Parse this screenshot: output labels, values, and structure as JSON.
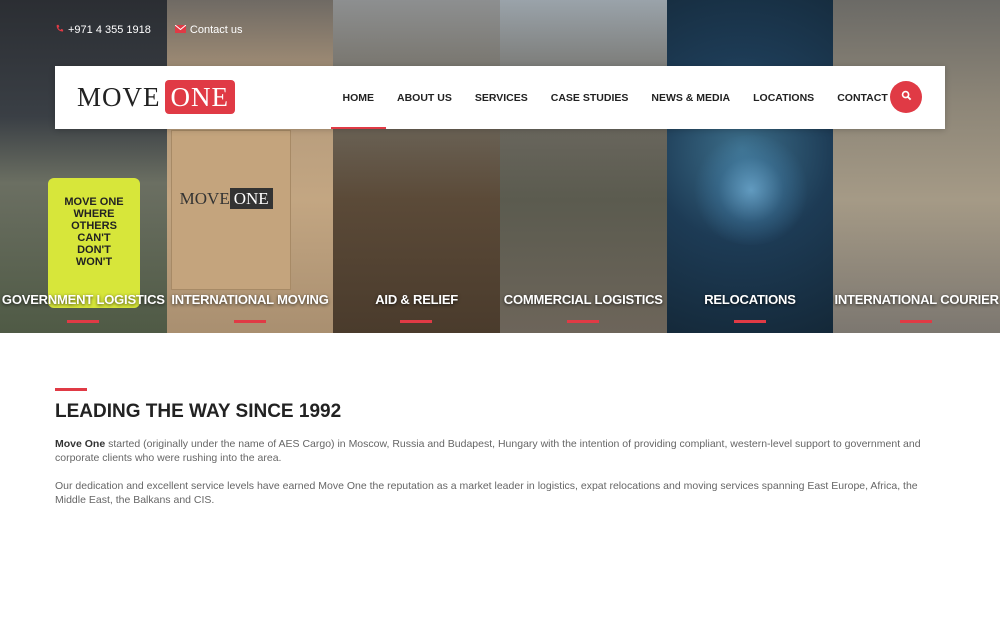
{
  "topbar": {
    "phone": "+971 4 355 1918",
    "contact": "Contact us",
    "phone_icon": "phone-icon",
    "mail_icon": "envelope-icon"
  },
  "brand": {
    "move": "MOVE",
    "one": "ONE",
    "accent": "#e03a45"
  },
  "nav": {
    "items": [
      "HOME",
      "ABOUT US",
      "SERVICES",
      "CASE STUDIES",
      "NEWS & MEDIA",
      "LOCATIONS",
      "CONTACT"
    ],
    "active": "HOME",
    "search_icon": "search-icon"
  },
  "tiles": [
    {
      "label": "GOVERNMENT LOGISTICS"
    },
    {
      "label": "INTERNATIONAL MOVING"
    },
    {
      "label": "AID & RELIEF"
    },
    {
      "label": "COMMERCIAL LOGISTICS"
    },
    {
      "label": "RELOCATIONS"
    },
    {
      "label": "INTERNATIONAL COURIER"
    }
  ],
  "imagery": {
    "vest_text": "MOVE ONE\nWHERE\nOTHERS\nCAN'T\nDON'T\nWON'T",
    "box_logo_move": "MOVE",
    "box_logo_one": "ONE"
  },
  "about": {
    "heading": "LEADING THE WAY SINCE 1992",
    "p1_bold": "Move One",
    "p1_rest": " started (originally under the name of AES Cargo) in Moscow, Russia and Budapest, Hungary with the intention of providing compliant, western-level support to government and corporate clients who were rushing into the area.",
    "p2": "Our dedication and excellent service levels have earned Move One the reputation as a market leader in logistics, expat relocations and moving services spanning East Europe, Africa, the Middle East, the Balkans and CIS."
  }
}
